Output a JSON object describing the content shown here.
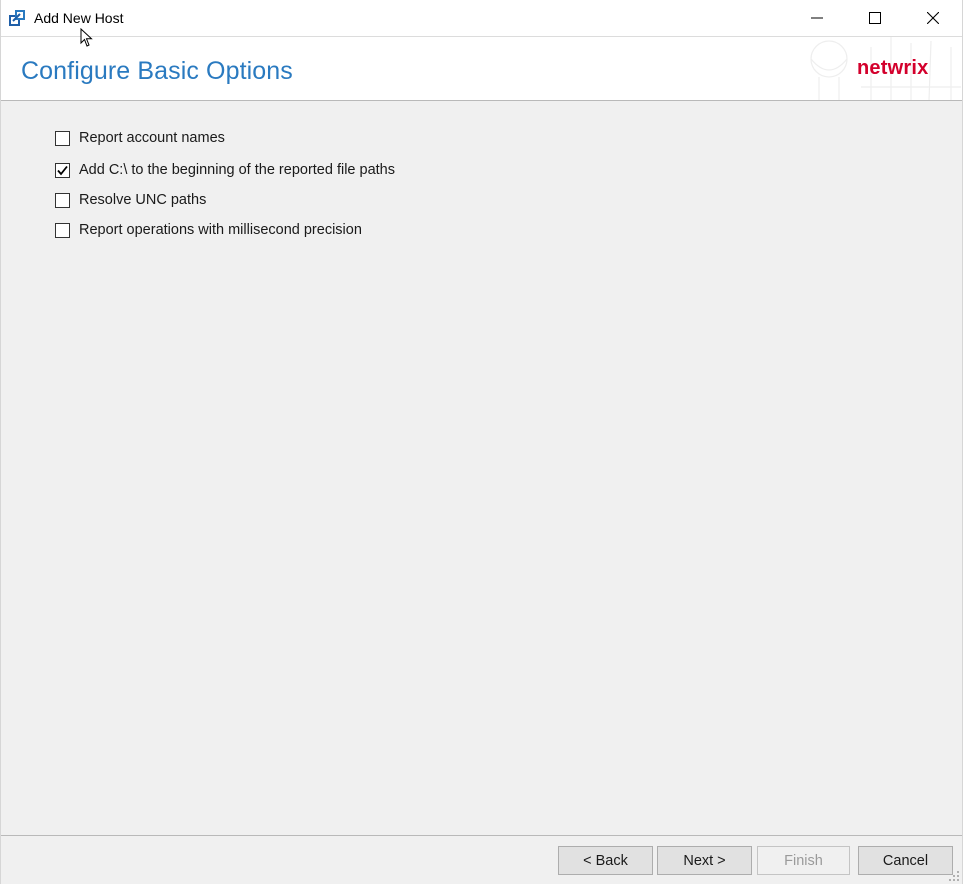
{
  "window": {
    "title": "Add New Host"
  },
  "header": {
    "title": "Configure Basic Options",
    "brand": "netwrix"
  },
  "options": [
    {
      "label": "Report account names",
      "checked": false
    },
    {
      "label": "Add C:\\ to the beginning of the reported file paths",
      "checked": true
    },
    {
      "label": "Resolve UNC paths",
      "checked": false
    },
    {
      "label": "Report operations with millisecond precision",
      "checked": false
    }
  ],
  "footer": {
    "back_label": "< Back",
    "next_label": "Next >",
    "finish_label": "Finish",
    "finish_enabled": false,
    "cancel_label": "Cancel"
  },
  "colors": {
    "title_blue": "#2a7ac0",
    "brand_red": "#d3002c",
    "dialog_bg": "#f0f0f0"
  },
  "icons": {
    "app": "host-app-icon",
    "minimize": "minimize-icon",
    "maximize": "maximize-icon",
    "close": "close-icon",
    "check": "checkmark-icon",
    "resize": "resize-grip-icon"
  }
}
